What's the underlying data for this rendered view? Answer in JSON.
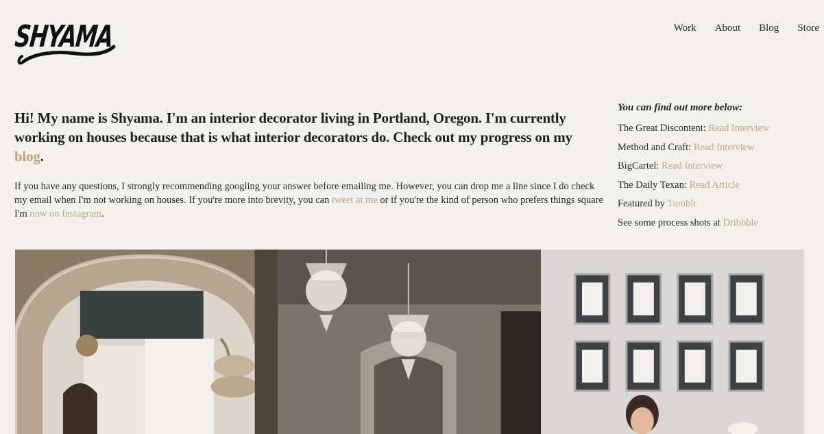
{
  "brand": {
    "logo_text": "SHYAMA"
  },
  "nav": [
    {
      "label": "Work"
    },
    {
      "label": "About"
    },
    {
      "label": "Blog"
    },
    {
      "label": "Store"
    }
  ],
  "intro": {
    "headline_before": "Hi! My name is Shyama. I'm an interior decorator living in Portland, Oregon. I'm currently working on houses because that is what interior decorators do. Check out my progress on my ",
    "headline_link": "blog",
    "headline_after": ".",
    "body_part1": "If you have any questions, I strongly recommending googling your answer before emailing me. However, you can drop me a line since I do check my email when I'm not working on houses. If you're more into brevity, you can ",
    "body_link1": "tweet at me",
    "body_part2": " or if you're the kind of person who prefers things square I'm ",
    "body_link2": "now on Instagram",
    "body_part3": "."
  },
  "side": {
    "heading": "You can find out more below:",
    "items": [
      {
        "text": "The Great Discontent: ",
        "link": "Read Interview"
      },
      {
        "text": "Method and Craft: ",
        "link": "Read Interview"
      },
      {
        "text": "BigCartel: ",
        "link": "Read Interview"
      },
      {
        "text": "The Daily Texan: ",
        "link": "Read Article"
      },
      {
        "text": "Featured by ",
        "link": "Tumblr"
      },
      {
        "text": "See some process shots at ",
        "link": "Dribbble"
      }
    ]
  },
  "colors": {
    "background": "#f2f1ed",
    "link": "#c9a27a",
    "text": "#1f1f1f"
  }
}
